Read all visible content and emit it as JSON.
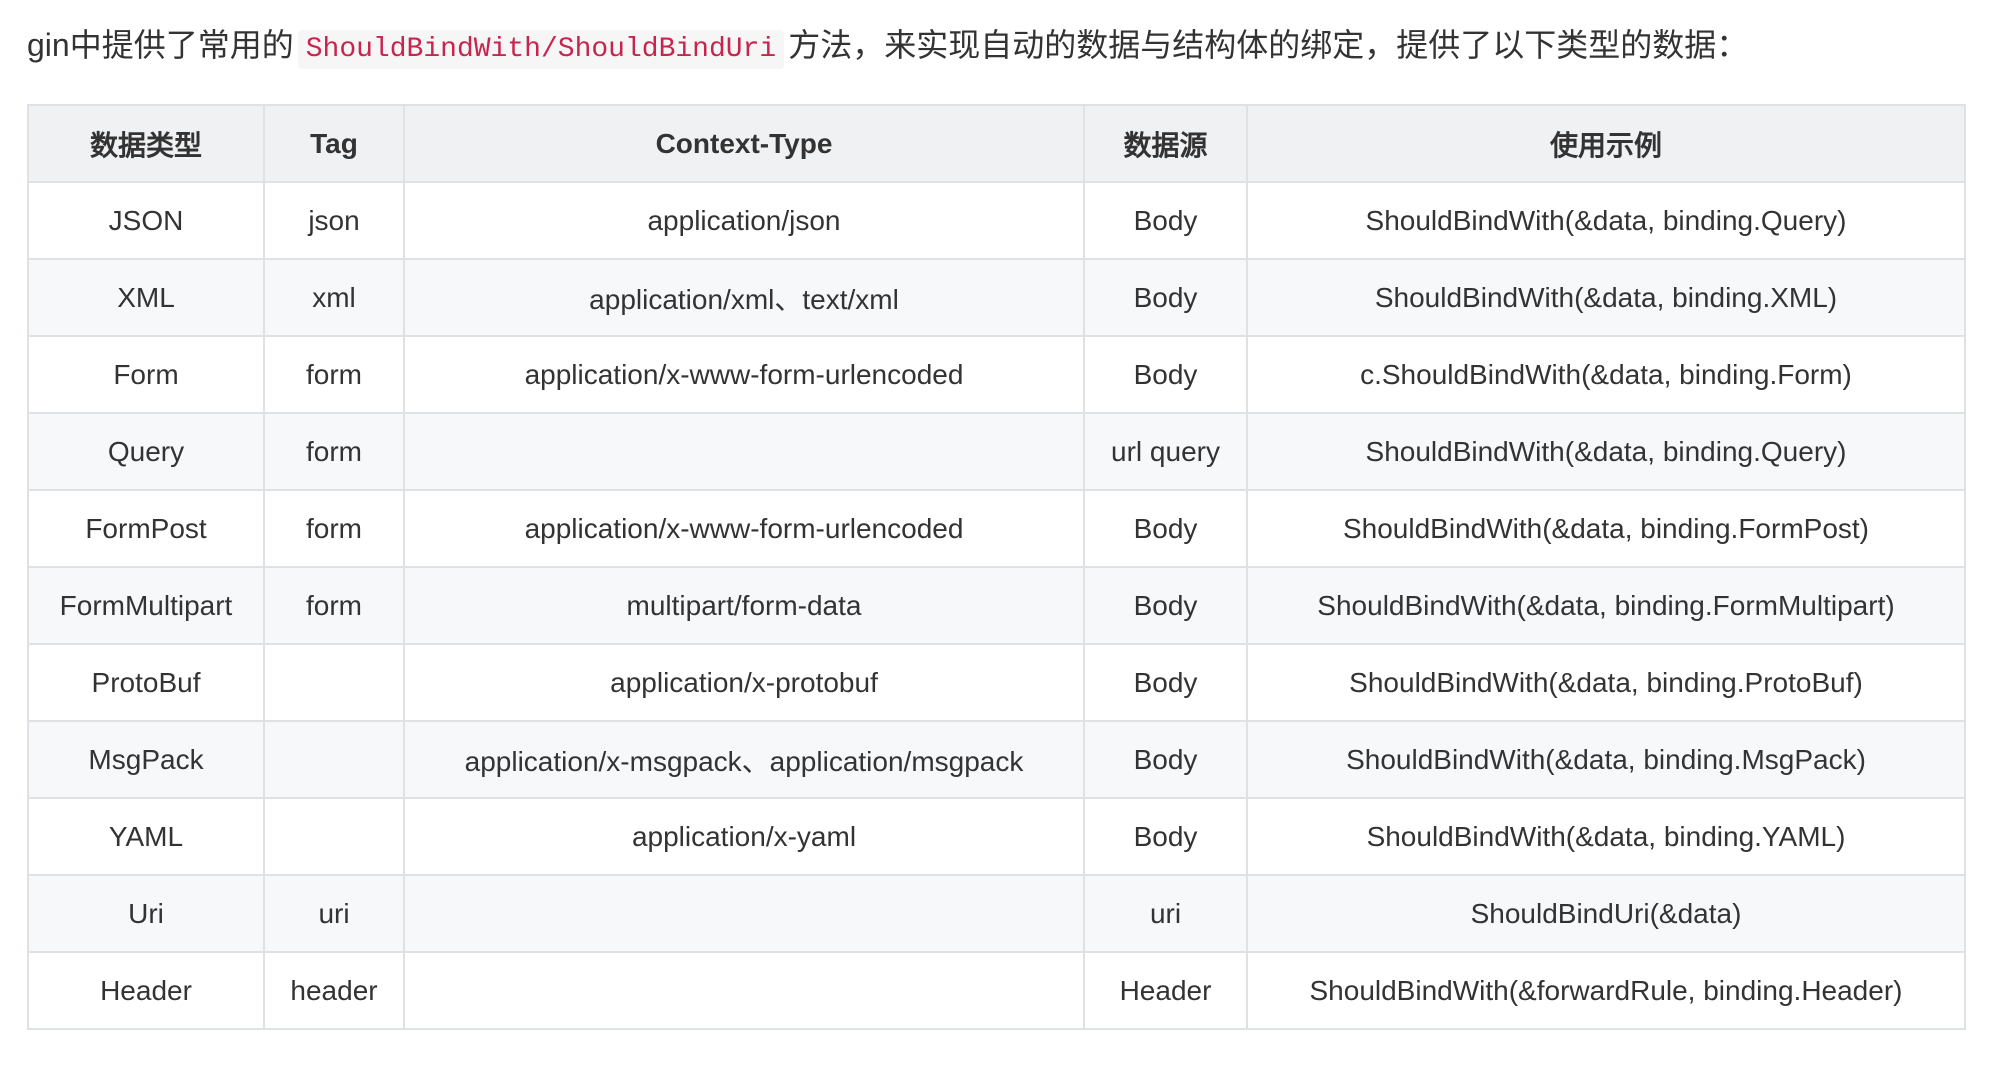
{
  "intro": {
    "prefix": "gin中提供了常用的",
    "code": "ShouldBindWith/ShouldBindUri",
    "suffix": "方法，来实现自动的数据与结构体的绑定，提供了以下类型的数据："
  },
  "table": {
    "headers": [
      "数据类型",
      "Tag",
      "Context-Type",
      "数据源",
      "使用示例"
    ],
    "rows": [
      [
        "JSON",
        "json",
        "application/json",
        "Body",
        "ShouldBindWith(&data, binding.Query)"
      ],
      [
        "XML",
        "xml",
        "application/xml、text/xml",
        "Body",
        "ShouldBindWith(&data, binding.XML)"
      ],
      [
        "Form",
        "form",
        "application/x-www-form-urlencoded",
        "Body",
        "c.ShouldBindWith(&data, binding.Form)"
      ],
      [
        "Query",
        "form",
        "",
        "url query",
        "ShouldBindWith(&data, binding.Query)"
      ],
      [
        "FormPost",
        "form",
        "application/x-www-form-urlencoded",
        "Body",
        "ShouldBindWith(&data, binding.FormPost)"
      ],
      [
        "FormMultipart",
        "form",
        "multipart/form-data",
        "Body",
        "ShouldBindWith(&data, binding.FormMultipart)"
      ],
      [
        "ProtoBuf",
        "",
        "application/x-protobuf",
        "Body",
        "ShouldBindWith(&data, binding.ProtoBuf)"
      ],
      [
        "MsgPack",
        "",
        "application/x-msgpack、application/msgpack",
        "Body",
        "ShouldBindWith(&data, binding.MsgPack)"
      ],
      [
        "YAML",
        "",
        "application/x-yaml",
        "Body",
        "ShouldBindWith(&data, binding.YAML)"
      ],
      [
        "Uri",
        "uri",
        "",
        "uri",
        "ShouldBindUri(&data)"
      ],
      [
        "Header",
        "header",
        "",
        "Header",
        "ShouldBindWith(&forwardRule, binding.Header)"
      ]
    ]
  },
  "colors": {
    "text": "#333333",
    "code_text": "#c7254e",
    "code_bg": "#f6f6f6",
    "header_bg": "#eff1f3",
    "stripe_bg": "#f6f8fa",
    "border": "#dfe2e5"
  }
}
